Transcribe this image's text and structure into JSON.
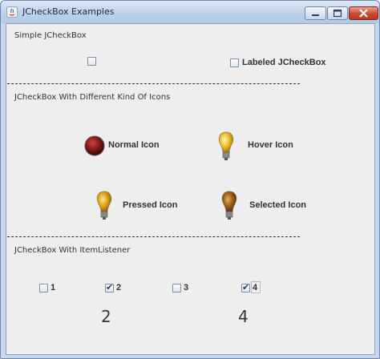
{
  "window": {
    "title": "JCheckBox Examples"
  },
  "section1": {
    "heading": "Simple JCheckBox",
    "labeled_checkbox": "Labeled JCheckBox"
  },
  "section2": {
    "heading": "JCheckBox With Different Kind Of Icons",
    "normal": "Normal Icon",
    "hover": "Hover Icon",
    "pressed": "Pressed Icon",
    "selected": "Selected Icon"
  },
  "section3": {
    "heading": "JCheckBox With ItemListener",
    "checkboxes": [
      {
        "label": "1",
        "checked": false
      },
      {
        "label": "2",
        "checked": true
      },
      {
        "label": "3",
        "checked": false
      },
      {
        "label": "4",
        "checked": true
      }
    ],
    "result_left": "2",
    "result_right": "4"
  },
  "icons": [
    "java-app-icon",
    "minimize-icon",
    "maximize-icon",
    "close-icon",
    "checkmark-icon",
    "red-ball-icon",
    "lightbulb-icon"
  ]
}
